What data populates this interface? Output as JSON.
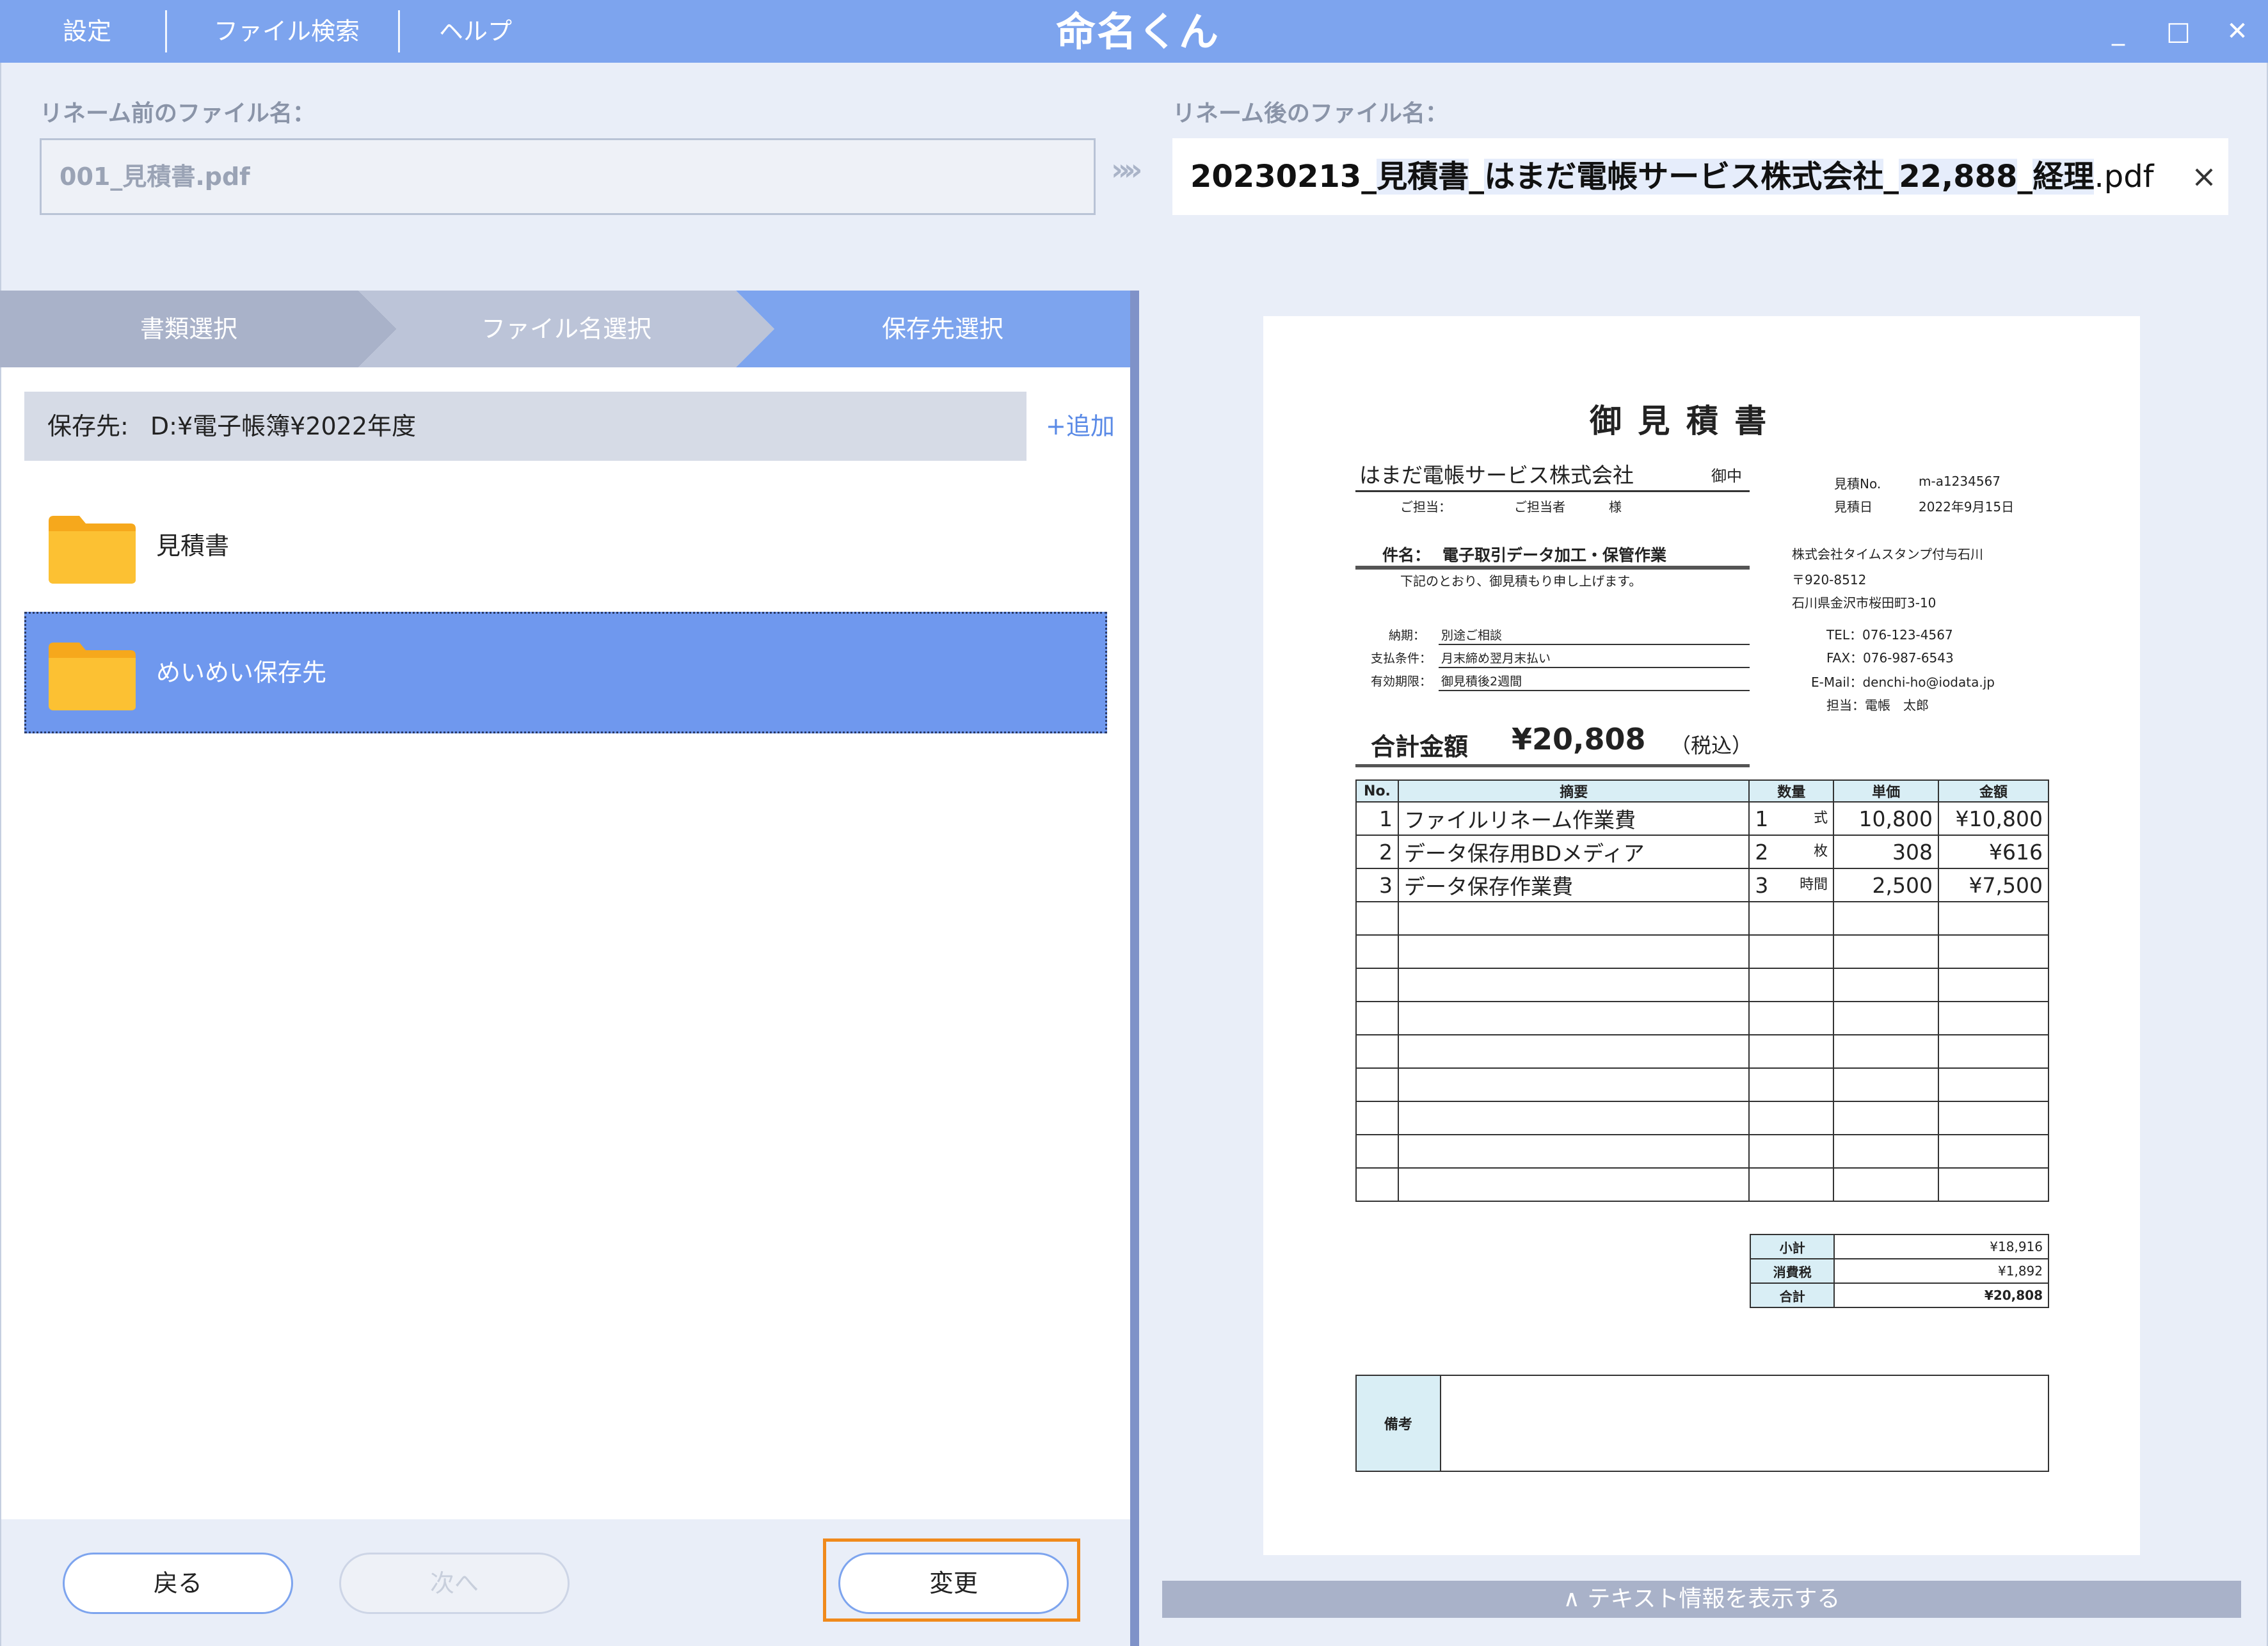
{
  "app": {
    "title": "命名くん"
  },
  "menu": {
    "settings": "設定",
    "file_search": "ファイル検索",
    "help": "ヘルプ"
  },
  "window_controls": {
    "minimize": "_",
    "maximize": "□",
    "close": "✕"
  },
  "rename": {
    "before_label": "リネーム前のファイル名：",
    "before_value": "001_見積書.pdf",
    "arrow": "»»",
    "after_label": "リネーム後のファイル名：",
    "after_segments": [
      "20230213",
      "_",
      "見積書",
      "_",
      "はまだ電帳サービス株式会社",
      "_",
      "22,888",
      "_",
      "経理",
      ".pdf"
    ],
    "clear": "×"
  },
  "steps": [
    "書類選択",
    "ファイル名選択",
    "保存先選択"
  ],
  "save": {
    "path_label": "保存先:",
    "path_value": "D:¥電子帳簿¥2022年度",
    "add": "+追加",
    "folders": [
      {
        "name": "見積書",
        "selected": false
      },
      {
        "name": "めいめい保存先",
        "selected": true
      }
    ]
  },
  "buttons": {
    "back": "戻る",
    "next": "次へ",
    "change": "変更"
  },
  "preview": {
    "toggle": "∧ テキスト情報を表示する",
    "doc": {
      "title": "御 見 積 書",
      "recipient": "はまだ電帳サービス株式会社",
      "honorific": "御中",
      "contact_label": "ご担当：",
      "contact_value": "ご担当者",
      "contact_sama": "様",
      "estimate_no_label": "見積No.",
      "estimate_no": "m-a1234567",
      "estimate_date_label": "見積日",
      "estimate_date": "2022年9月15日",
      "subject_label": "件名：",
      "subject": "電子取引データ加工・保管作業",
      "note": "下記のとおり、御見積もり申し上げます。",
      "issuer_name": "株式会社タイムスタンプ付与石川",
      "issuer_zip": "〒920-8512",
      "issuer_address": "石川県金沢市桜田町3-10",
      "tel": "TEL：076-123-4567",
      "fax": "FAX：076-987-6543",
      "email": "E-Mail：denchi-ho@iodata.jp",
      "person": "担当：電帳　太郎",
      "terms": [
        {
          "label": "納期：",
          "value": "別途ご相談"
        },
        {
          "label": "支払条件：",
          "value": "月末締め翌月末払い"
        },
        {
          "label": "有効期限：",
          "value": "御見積後2週間"
        }
      ],
      "total_label": "合計金額",
      "total_value": "¥20,808",
      "tax_note": "（税込）",
      "columns": [
        "No.",
        "摘要",
        "数量",
        "単価",
        "金額"
      ],
      "items": [
        {
          "no": "1",
          "desc": "ファイルリネーム作業費",
          "qty": "1",
          "unit": "式",
          "price": "10,800",
          "amount": "¥10,800"
        },
        {
          "no": "2",
          "desc": "データ保存用BDメディア",
          "qty": "2",
          "unit": "枚",
          "price": "308",
          "amount": "¥616"
        },
        {
          "no": "3",
          "desc": "データ保存作業費",
          "qty": "3",
          "unit": "時間",
          "price": "2,500",
          "amount": "¥7,500"
        }
      ],
      "subtotal_label": "小計",
      "subtotal": "¥18,916",
      "tax_label": "消費税",
      "tax": "¥1,892",
      "grand_label": "合計",
      "grand": "¥20,808",
      "remarks_label": "備考"
    }
  },
  "colors": {
    "accent": "#7da4ee",
    "selected": "#6f98ee",
    "highlight_frame": "#f08a1c"
  }
}
